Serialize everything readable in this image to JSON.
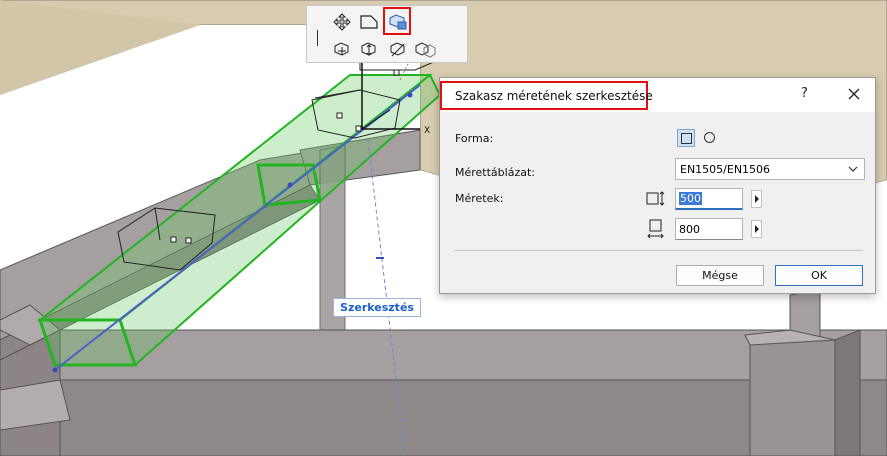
{
  "viewport": {
    "axis_label": "X",
    "editing_tag": "Szerkesztés"
  },
  "pet_palette": {
    "icons": [
      "move-icon",
      "reshape-icon",
      "edit-segment-size-icon",
      "offset-icon",
      "elevation-icon",
      "stretch-icon",
      "split-icon"
    ],
    "active_icon": "edit-segment-size-icon",
    "highlight_color": "#e01010"
  },
  "dialog": {
    "title": "Szakasz méretének szerkesztése",
    "help": "?",
    "shape_label": "Forma:",
    "shape_options": [
      "rectangle-icon",
      "circle-icon"
    ],
    "shape_selected": "rectangle-icon",
    "table_label": "Mérettáblázat:",
    "table_value": "EN1505/EN1506",
    "dims_label": "Méretek:",
    "width_value": "500",
    "height_value": "800",
    "cancel_label": "Mégse",
    "ok_label": "OK",
    "accent_color": "#2f6fc8"
  }
}
